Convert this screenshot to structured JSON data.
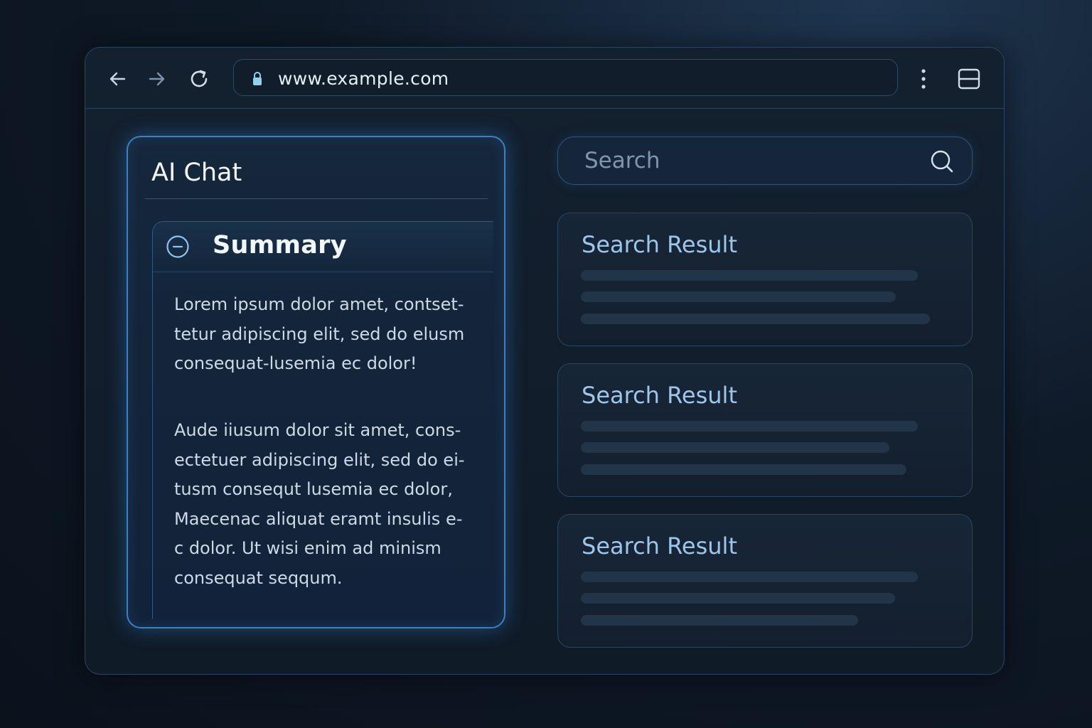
{
  "browser": {
    "url": "www.example.com",
    "icons": {
      "back": "arrow-left-icon",
      "forward": "arrow-right-icon",
      "reload": "reload-icon",
      "lock": "lock-icon",
      "menu": "kebab-menu-icon",
      "window": "window-icon"
    }
  },
  "chat": {
    "title": "AI Chat",
    "summary": {
      "title": "Summary",
      "icon": "collapse-minus-icon",
      "paragraphs": [
        "Lorem ipsum  dolor amet, contset-\ntetur adipiscing elit, sed do elusm\nconsequat-lusemia ec dolor!",
        "Aude iiusum dolor sit amet, cons-\nectetuer adipiscing elit, sed do ei-\ntusm consequt lusemia ec dolor,\nMaecenac aliquat eramt insulis e-\nc dolor. Ut wisi enim ad minism\nconsequat seqqum."
      ]
    }
  },
  "search": {
    "placeholder": "Search",
    "icon": "search-icon"
  },
  "results": [
    {
      "title": "Search Result"
    },
    {
      "title": "Search Result"
    },
    {
      "title": "Search Result"
    }
  ],
  "colors": {
    "accent": "#3d7fc0",
    "result_title": "#9ec6ea",
    "background": "#0f1a28"
  }
}
